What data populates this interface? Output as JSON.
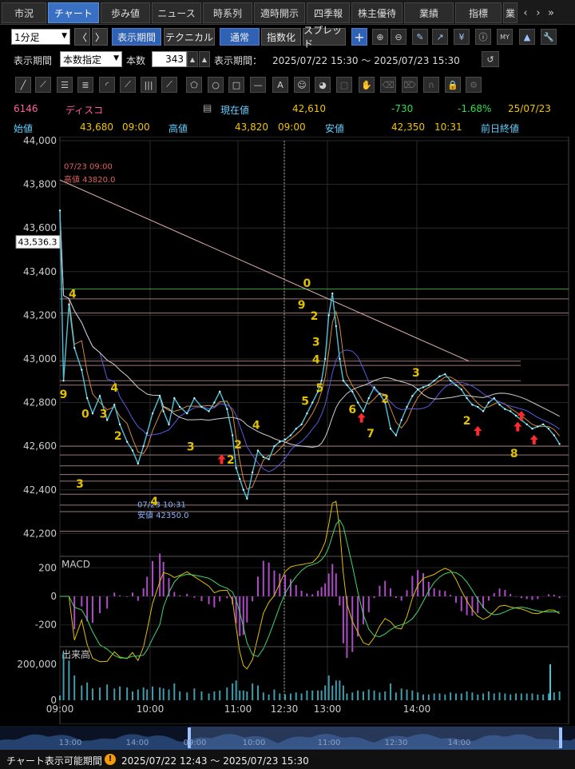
{
  "tabs": [
    {
      "label": "市況",
      "active": false
    },
    {
      "label": "チャート",
      "active": true
    },
    {
      "label": "歩み値",
      "active": false
    },
    {
      "label": "ニュース",
      "active": false
    },
    {
      "label": "時系列",
      "active": false
    },
    {
      "label": "適時開示",
      "active": false
    },
    {
      "label": "四季報",
      "active": false
    },
    {
      "label": "株主優待",
      "active": false
    },
    {
      "label": "業績",
      "active": false
    },
    {
      "label": "指標",
      "active": false
    },
    {
      "label": "業",
      "active": false
    }
  ],
  "toolbar1": {
    "interval": "1分足",
    "prev": "〈",
    "next": "〉",
    "period_btn": "表示期間",
    "technical_btn": "テクニカル",
    "normal_btn": "通常",
    "index_btn": "指数化",
    "spread_btn": "スプレッド",
    "plus": "+"
  },
  "toolbar2": {
    "period_label": "表示期間",
    "period_mode": "本数指定",
    "count_label": "本数",
    "count_value": "343",
    "range_label": "表示期間：",
    "range_value": "2025/07/22 15:30 ～ 2025/07/23 15:30"
  },
  "quote": {
    "code": "6146",
    "name": "ディスコ",
    "current_label": "現在値",
    "current_value": "42,610",
    "change": "-730",
    "change_pct": "-1.68%",
    "date": "25/07/23",
    "open_label": "始値",
    "open_value": "43,680",
    "open_time": "09:00",
    "high_label": "高値",
    "high_value": "43,820",
    "high_time": "09:00",
    "low_label": "安値",
    "low_value": "42,350",
    "low_time": "10:31",
    "prev_close_label": "前日終値"
  },
  "chart_data": {
    "type": "line",
    "title": "",
    "xlabel": "",
    "ylabel": "",
    "ylim": [
      42150,
      44000
    ],
    "y_ticks": [
      44000,
      43800,
      43600,
      43400,
      43200,
      43000,
      42800,
      42600,
      42400,
      42200
    ],
    "x_ticks": [
      "09:00",
      "10:00",
      "11:00",
      "12:30",
      "13:00",
      "14:00"
    ],
    "cursor_price": "43,536.3",
    "high_annotation": [
      "07/23 09:00",
      "高値 43820.0"
    ],
    "low_annotation": [
      "07/23 10:31",
      "安値 42350.0"
    ],
    "series": [
      {
        "name": "",
        "values": [
          [
            0,
            43680
          ],
          [
            2,
            42900
          ],
          [
            5,
            43250
          ],
          [
            8,
            43050
          ],
          [
            12,
            42950
          ],
          [
            15,
            42820
          ],
          [
            18,
            42750
          ],
          [
            22,
            42830
          ],
          [
            26,
            42720
          ],
          [
            30,
            42790
          ],
          [
            33,
            42700
          ],
          [
            37,
            42620
          ],
          [
            40,
            42580
          ],
          [
            43,
            42520
          ],
          [
            46,
            42600
          ],
          [
            48,
            42660
          ],
          [
            51,
            42750
          ],
          [
            55,
            42830
          ],
          [
            57,
            42760
          ],
          [
            60,
            42700
          ],
          [
            63,
            42820
          ],
          [
            66,
            42780
          ],
          [
            70,
            42750
          ],
          [
            74,
            42820
          ],
          [
            78,
            42780
          ],
          [
            82,
            42760
          ],
          [
            85,
            42800
          ],
          [
            88,
            42850
          ],
          [
            92,
            42770
          ],
          [
            95,
            42650
          ],
          [
            97,
            42500
          ],
          [
            99,
            42450
          ],
          [
            101,
            42400
          ],
          [
            103,
            42360
          ],
          [
            106,
            42480
          ],
          [
            109,
            42580
          ],
          [
            112,
            42550
          ],
          [
            115,
            42540
          ],
          [
            118,
            42600
          ],
          [
            121,
            42620
          ],
          [
            124,
            42630
          ],
          [
            127,
            42650
          ],
          [
            130,
            42680
          ],
          [
            133,
            42700
          ],
          [
            136,
            42750
          ],
          [
            139,
            42800
          ],
          [
            142,
            42850
          ],
          [
            144,
            42900
          ],
          [
            146,
            43000
          ],
          [
            148,
            43200
          ],
          [
            150,
            43300
          ],
          [
            152,
            43150
          ],
          [
            154,
            43000
          ],
          [
            156,
            42900
          ],
          [
            158,
            42880
          ],
          [
            161,
            42850
          ],
          [
            164,
            42800
          ],
          [
            167,
            42760
          ],
          [
            170,
            42820
          ],
          [
            173,
            42870
          ],
          [
            176,
            42840
          ],
          [
            179,
            42800
          ],
          [
            182,
            42680
          ],
          [
            185,
            42650
          ],
          [
            188,
            42720
          ],
          [
            191,
            42780
          ],
          [
            194,
            42830
          ],
          [
            197,
            42860
          ],
          [
            200,
            42870
          ],
          [
            203,
            42880
          ],
          [
            206,
            42900
          ],
          [
            209,
            42920
          ],
          [
            212,
            42930
          ],
          [
            215,
            42900
          ],
          [
            218,
            42880
          ],
          [
            221,
            42860
          ],
          [
            224,
            42820
          ],
          [
            227,
            42790
          ],
          [
            230,
            42780
          ],
          [
            233,
            42760
          ],
          [
            236,
            42800
          ],
          [
            239,
            42820
          ],
          [
            242,
            42790
          ],
          [
            245,
            42770
          ],
          [
            248,
            42760
          ],
          [
            251,
            42740
          ],
          [
            254,
            42720
          ],
          [
            257,
            42700
          ],
          [
            260,
            42680
          ],
          [
            263,
            42690
          ],
          [
            266,
            42700
          ],
          [
            269,
            42680
          ],
          [
            272,
            42650
          ],
          [
            275,
            42610
          ]
        ]
      }
    ],
    "reference_levels": [
      43320,
      43275,
      43210,
      42990,
      42970,
      42900,
      42880,
      42600,
      42560,
      42510,
      42470,
      42440,
      42380,
      42330,
      42300,
      42210
    ],
    "trendline": {
      "from": [
        0,
        43820
      ],
      "to": [
        225,
        42990
      ]
    },
    "wave_labels": [
      {
        "t": 2,
        "p": 42820,
        "label": "9"
      },
      {
        "t": 7,
        "p": 43280,
        "label": "4"
      },
      {
        "t": 14,
        "p": 42730,
        "label": "0"
      },
      {
        "t": 11,
        "p": 42410,
        "label": "3"
      },
      {
        "t": 24,
        "p": 42730,
        "label": "3"
      },
      {
        "t": 30,
        "p": 42850,
        "label": "4"
      },
      {
        "t": 32,
        "p": 42630,
        "label": "2"
      },
      {
        "t": 52,
        "p": 42330,
        "label": "4"
      },
      {
        "t": 72,
        "p": 42580,
        "label": "3"
      },
      {
        "t": 94,
        "p": 42520,
        "label": "2"
      },
      {
        "t": 98,
        "p": 42590,
        "label": "2"
      },
      {
        "t": 108,
        "p": 42680,
        "label": "4"
      },
      {
        "t": 135,
        "p": 42790,
        "label": "5"
      },
      {
        "t": 136,
        "p": 43330,
        "label": "0"
      },
      {
        "t": 133,
        "p": 43230,
        "label": "9"
      },
      {
        "t": 140,
        "p": 43180,
        "label": "2"
      },
      {
        "t": 141,
        "p": 43060,
        "label": "3"
      },
      {
        "t": 141,
        "p": 42980,
        "label": "4"
      },
      {
        "t": 143,
        "p": 42850,
        "label": "5"
      },
      {
        "t": 161,
        "p": 42750,
        "label": "6"
      },
      {
        "t": 171,
        "p": 42640,
        "label": "7"
      },
      {
        "t": 179,
        "p": 42800,
        "label": "2"
      },
      {
        "t": 196,
        "p": 42920,
        "label": "3"
      },
      {
        "t": 224,
        "p": 42700,
        "label": "2"
      },
      {
        "t": 250,
        "p": 42550,
        "label": "8"
      }
    ],
    "up_arrows": [
      {
        "t": 89,
        "p": 42540
      },
      {
        "t": 166,
        "p": 42730
      },
      {
        "t": 230,
        "p": 42670
      },
      {
        "t": 252,
        "p": 42690
      },
      {
        "t": 254,
        "p": 42740
      },
      {
        "t": 261,
        "p": 42630
      }
    ],
    "macd": {
      "label": "MACD",
      "ticks": [
        "200",
        "0",
        "-200"
      ],
      "ylim": [
        -280,
        280
      ]
    },
    "volume": {
      "label": "出来高",
      "ticks": [
        "200,000",
        "0"
      ]
    },
    "navigator_ticks": [
      "13:00",
      "14:00",
      "09:00",
      "10:00",
      "11:00",
      "12:30",
      "14:00"
    ]
  },
  "status": {
    "label": "チャート表示可能期間",
    "range": "2025/07/22 12:43 ～ 2025/07/23 15:30"
  },
  "colors": {
    "accent": "#3a70c4",
    "price": "#f2c400",
    "down": "#2be04f",
    "line": "#4fc3d8",
    "label": "#e0c000",
    "arrow": "#ff2a2a"
  }
}
